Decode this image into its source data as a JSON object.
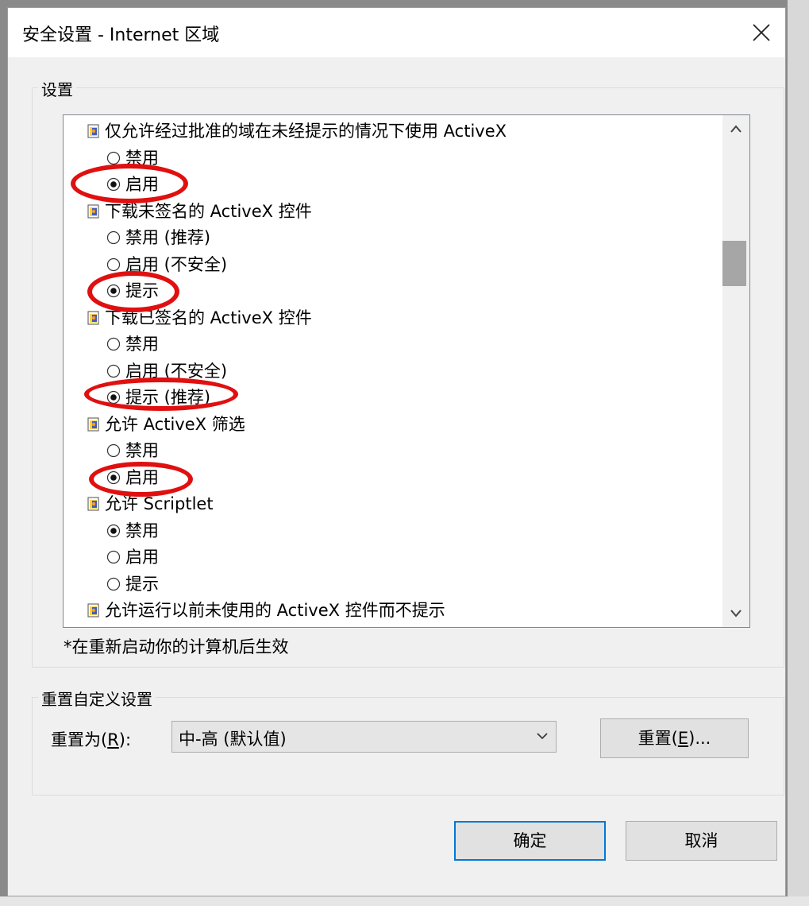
{
  "window": {
    "title": "安全设置 - Internet 区域"
  },
  "settings_group": {
    "label": "设置",
    "items": [
      {
        "kind": "header",
        "text": "仅允许经过批准的域在未经提示的情况下使用 ActiveX"
      },
      {
        "kind": "radio",
        "text": "禁用",
        "checked": false
      },
      {
        "kind": "radio",
        "text": "启用",
        "checked": true
      },
      {
        "kind": "header",
        "text": "下载未签名的 ActiveX 控件"
      },
      {
        "kind": "radio",
        "text": "禁用 (推荐)",
        "checked": false
      },
      {
        "kind": "radio",
        "text": "启用 (不安全)",
        "checked": false
      },
      {
        "kind": "radio",
        "text": "提示",
        "checked": true
      },
      {
        "kind": "header",
        "text": "下载已签名的 ActiveX 控件"
      },
      {
        "kind": "radio",
        "text": "禁用",
        "checked": false
      },
      {
        "kind": "radio",
        "text": "启用 (不安全)",
        "checked": false
      },
      {
        "kind": "radio",
        "text": "提示 (推荐)",
        "checked": true
      },
      {
        "kind": "header",
        "text": "允许 ActiveX 筛选"
      },
      {
        "kind": "radio",
        "text": "禁用",
        "checked": false
      },
      {
        "kind": "radio",
        "text": "启用",
        "checked": true
      },
      {
        "kind": "header",
        "text": "允许 Scriptlet"
      },
      {
        "kind": "radio",
        "text": "禁用",
        "checked": true
      },
      {
        "kind": "radio",
        "text": "启用",
        "checked": false
      },
      {
        "kind": "radio",
        "text": "提示",
        "checked": false
      },
      {
        "kind": "header",
        "text": "允许运行以前未使用的 ActiveX 控件而不提示"
      }
    ],
    "note": "*在重新启动你的计算机后生效"
  },
  "annotations": {
    "highlight_color": "#e01010",
    "highlighted_items": [
      2,
      6,
      10,
      13
    ]
  },
  "reset_group": {
    "label": "重置自定义设置",
    "reset_to_label": "重置为",
    "reset_to_accel": "R",
    "reset_to_suffix": "):",
    "selected_value": "中-高 (默认值)",
    "reset_button_label": "重置",
    "reset_button_accel": "E",
    "reset_button_suffix": ")..."
  },
  "buttons": {
    "ok": "确定",
    "cancel": "取消"
  },
  "colors": {
    "primary_border": "#0078d7",
    "scroll_thumb": "#a6a6a6"
  }
}
